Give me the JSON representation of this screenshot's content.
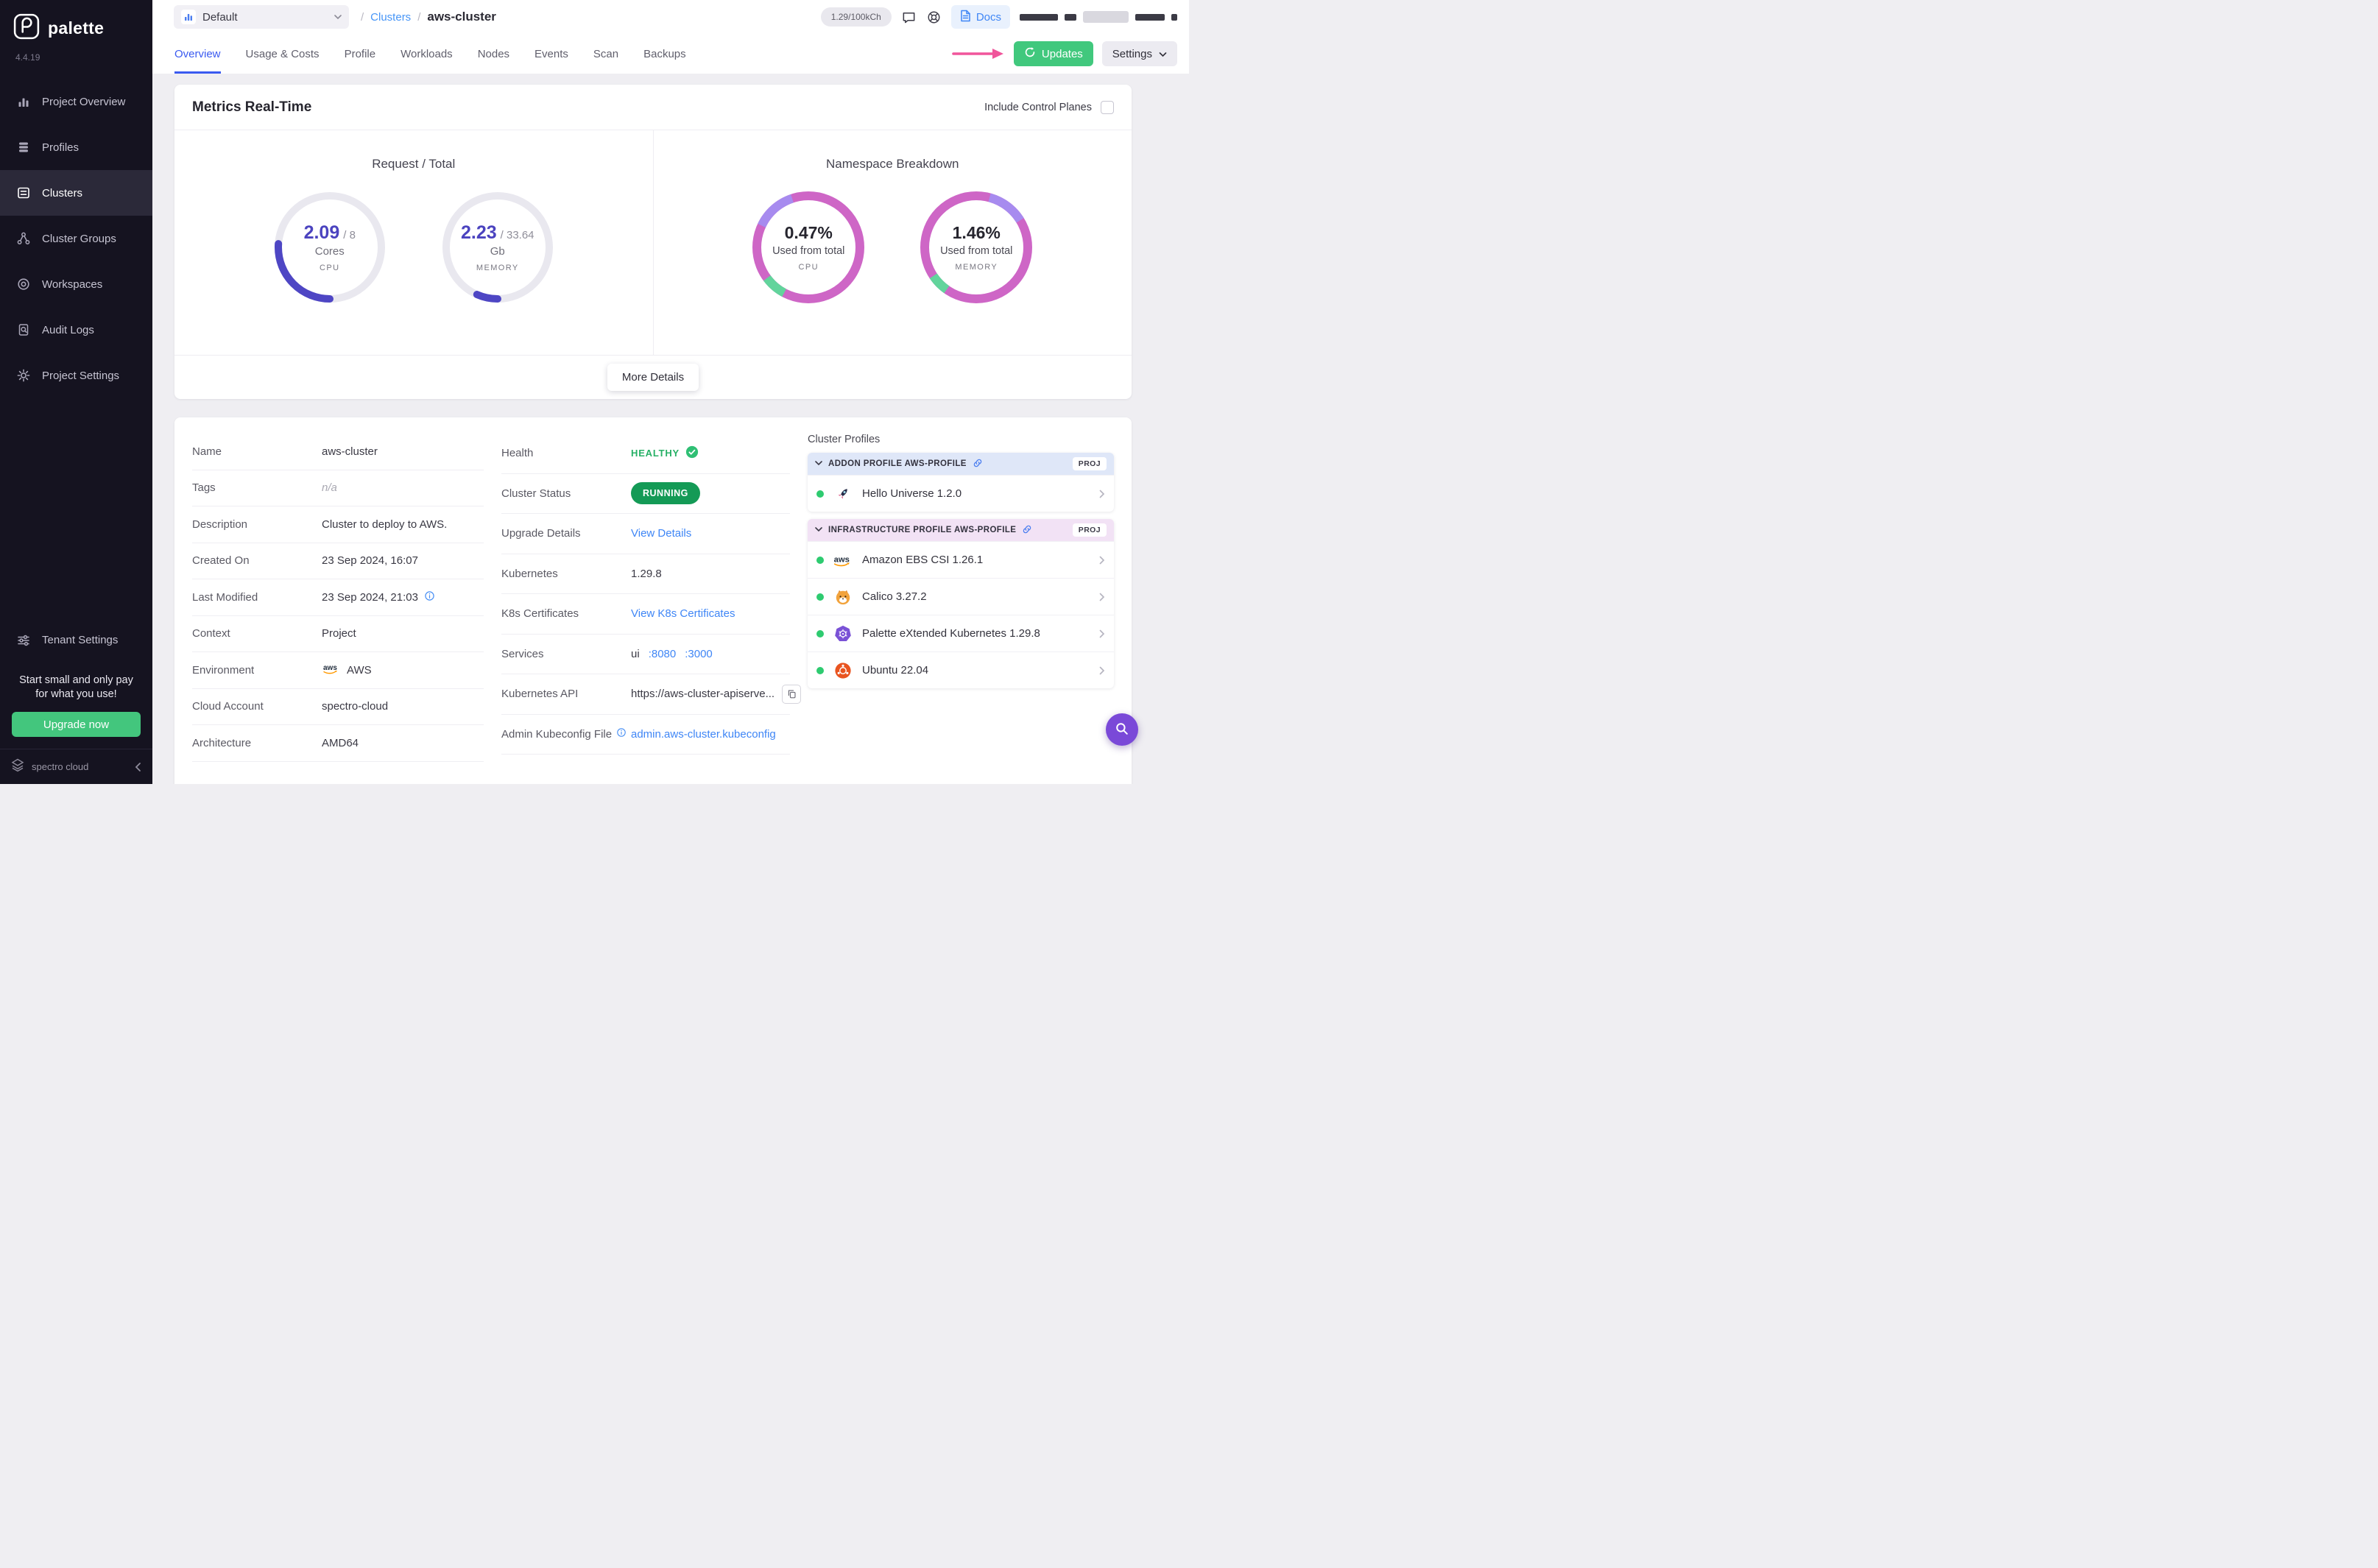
{
  "sidebar": {
    "brand": "palette",
    "version": "4.4.19",
    "items": [
      {
        "label": "Project Overview"
      },
      {
        "label": "Profiles"
      },
      {
        "label": "Clusters"
      },
      {
        "label": "Cluster Groups"
      },
      {
        "label": "Workspaces"
      },
      {
        "label": "Audit Logs"
      },
      {
        "label": "Project Settings"
      }
    ],
    "tenant_settings_label": "Tenant Settings",
    "promo": {
      "line1": "Start small and only pay",
      "line2": "for what you use!",
      "cta": "Upgrade now"
    },
    "footer_brand": "spectro cloud"
  },
  "header": {
    "project_selector": "Default",
    "breadcrumb_separator": "/",
    "breadcrumb_section": "Clusters",
    "breadcrumb_current": "aws-cluster",
    "usage_pill": "1.29/100kCh",
    "docs_label": "Docs"
  },
  "tabs": [
    {
      "label": "Overview"
    },
    {
      "label": "Usage & Costs"
    },
    {
      "label": "Profile"
    },
    {
      "label": "Workloads"
    },
    {
      "label": "Nodes"
    },
    {
      "label": "Events"
    },
    {
      "label": "Scan"
    },
    {
      "label": "Backups"
    }
  ],
  "toolbar": {
    "updates_label": "Updates",
    "settings_label": "Settings"
  },
  "metrics": {
    "title": "Metrics Real-Time",
    "include_control_planes_label": "Include Control Planes",
    "request_total_heading": "Request / Total",
    "namespace_heading": "Namespace Breakdown",
    "more_details_label": "More Details",
    "gauges": [
      {
        "value": "2.09",
        "total": "/ 8",
        "unit": "Cores",
        "label": "CPU",
        "fraction": 0.261
      },
      {
        "value": "2.23",
        "total": "/ 33.64",
        "unit": "Gb",
        "label": "MEMORY",
        "fraction": 0.066
      }
    ],
    "donuts": [
      {
        "percent": "0.47%",
        "caption": "Used from total",
        "label": "CPU"
      },
      {
        "percent": "1.46%",
        "caption": "Used from total",
        "label": "MEMORY"
      }
    ]
  },
  "overview": {
    "fields": [
      {
        "label": "Name",
        "value": "aws-cluster"
      },
      {
        "label": "Tags",
        "value": "n/a"
      },
      {
        "label": "Description",
        "value": "Cluster to deploy to AWS."
      },
      {
        "label": "Created On",
        "value": "23 Sep 2024, 16:07"
      },
      {
        "label": "Last Modified",
        "value": "23 Sep 2024, 21:03"
      },
      {
        "label": "Context",
        "value": "Project"
      },
      {
        "label": "Environment",
        "value": "AWS"
      },
      {
        "label": "Cloud Account",
        "value": "spectro-cloud"
      },
      {
        "label": "Architecture",
        "value": "AMD64"
      }
    ],
    "status": {
      "health_label": "Health",
      "health_value": "HEALTHY",
      "cluster_status_label": "Cluster Status",
      "cluster_status_value": "RUNNING",
      "upgrade_label": "Upgrade Details",
      "upgrade_link": "View Details",
      "kubernetes_label": "Kubernetes",
      "kubernetes_value": "1.29.8",
      "certificates_label": "K8s Certificates",
      "certificates_link": "View K8s Certificates",
      "services_label": "Services",
      "services_value": "ui",
      "services_port1": ":8080",
      "services_port2": ":3000",
      "api_label": "Kubernetes API",
      "api_value": "https://aws-cluster-apiserve...",
      "kubeconfig_label": "Admin Kubeconfig File",
      "kubeconfig_link": "admin.aws-cluster.kubeconfig"
    }
  },
  "cluster_profiles": {
    "title": "Cluster Profiles",
    "groups": [
      {
        "header": "ADDON PROFILE AWS-PROFILE",
        "badge": "PROJ",
        "items": [
          {
            "name": "Hello Universe 1.2.0"
          }
        ]
      },
      {
        "header": "INFRASTRUCTURE PROFILE AWS-PROFILE",
        "badge": "PROJ",
        "items": [
          {
            "name": "Amazon EBS CSI 1.26.1"
          },
          {
            "name": "Calico 3.27.2"
          },
          {
            "name": "Palette eXtended Kubernetes 1.29.8"
          },
          {
            "name": "Ubuntu 22.04"
          }
        ]
      }
    ]
  },
  "colors": {
    "accent_green": "#41c87d",
    "status_green": "#149a56",
    "link_blue": "#3f86f6",
    "active_tab_blue": "#3a5af0",
    "donut_magenta": "#ce66c6",
    "gauge_indigo": "#4e46c4",
    "annotation_pink": "#f0559b"
  }
}
